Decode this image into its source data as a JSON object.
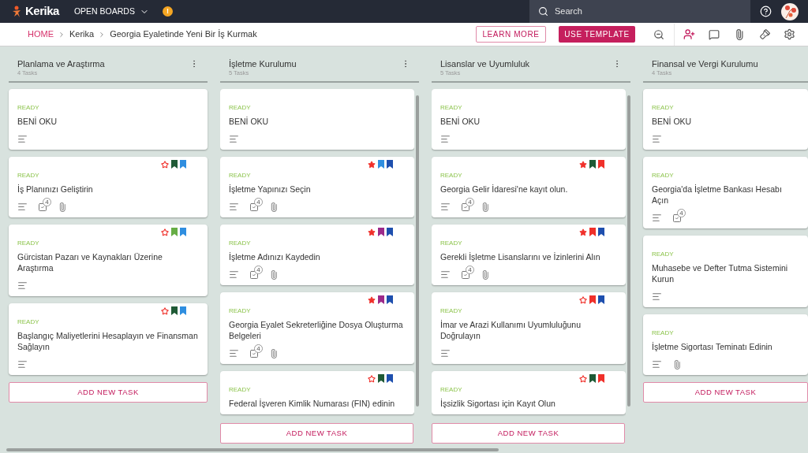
{
  "topbar": {
    "logo": "Kerika",
    "boards_menu": "OPEN BOARDS",
    "alert_badge": "!",
    "search": {
      "placeholder": "Search"
    }
  },
  "breadcrumb": {
    "items": [
      {
        "label": "HOME",
        "kind": "link"
      },
      {
        "label": "Kerika",
        "kind": "text"
      },
      {
        "label": "Georgia Eyaletinde Yeni Bir İş Kurmak",
        "kind": "text"
      }
    ],
    "buttons": [
      {
        "label": "LEARN MORE",
        "kind": "outline"
      },
      {
        "label": "USE TEMPLATE",
        "kind": "filled"
      }
    ]
  },
  "columns": [
    {
      "title": "Planlama ve Araştırma",
      "count": "4 Tasks",
      "has_menu": true,
      "scrolling": false,
      "add_button": "ADD NEW TASK",
      "cards": [
        {
          "status": "READY",
          "title": "BENİ OKU",
          "icons": [
            {
              "kind": "description"
            }
          ]
        },
        {
          "status": "READY",
          "title": "İş Planınızı Geliştirin",
          "starred": false,
          "flags": [
            {
              "color": "#1f5a36"
            },
            {
              "color": "#2f8ee0"
            }
          ],
          "icons": [
            {
              "kind": "description"
            },
            {
              "kind": "checklist",
              "count": "4"
            },
            {
              "kind": "attachment"
            }
          ]
        },
        {
          "status": "READY",
          "title": "Gürcistan Pazarı ve Kaynakları Üzerine Araştırma",
          "starred": false,
          "flags": [
            {
              "color": "#66ad45"
            },
            {
              "color": "#2f8ee0"
            }
          ],
          "icons": [
            {
              "kind": "description"
            }
          ]
        },
        {
          "status": "READY",
          "title": "Başlangıç Maliyetlerini Hesaplayın ve Finansman Sağlayın",
          "starred": false,
          "flags": [
            {
              "color": "#1f5a36"
            },
            {
              "color": "#2f8ee0"
            }
          ],
          "icons": [
            {
              "kind": "description"
            }
          ]
        }
      ]
    },
    {
      "title": "İşletme Kurulumu",
      "count": "5 Tasks",
      "has_menu": true,
      "scrolling": true,
      "add_button": "ADD NEW TASK",
      "cards": [
        {
          "status": "READY",
          "title": "BENİ OKU",
          "icons": [
            {
              "kind": "description"
            }
          ]
        },
        {
          "status": "READY",
          "title": "İşletme Yapınızı Seçin",
          "starred": true,
          "flags": [
            {
              "color": "#2f8ee0"
            },
            {
              "color": "#1e4fae"
            }
          ],
          "icons": [
            {
              "kind": "description"
            },
            {
              "kind": "checklist",
              "count": "4"
            },
            {
              "kind": "attachment"
            }
          ]
        },
        {
          "status": "READY",
          "title": "İşletme Adınızı Kaydedin",
          "starred": true,
          "flags": [
            {
              "color": "#9c2a8a"
            },
            {
              "color": "#1e4fae"
            }
          ],
          "icons": [
            {
              "kind": "description"
            },
            {
              "kind": "checklist",
              "count": "4"
            },
            {
              "kind": "attachment"
            }
          ]
        },
        {
          "status": "READY",
          "title": "Georgia Eyalet Sekreterliğine Dosya Oluşturma Belgeleri",
          "starred": true,
          "flags": [
            {
              "color": "#9c2a8a"
            },
            {
              "color": "#1e4fae"
            }
          ],
          "icons": [
            {
              "kind": "description"
            },
            {
              "kind": "checklist",
              "count": "4"
            },
            {
              "kind": "attachment"
            }
          ]
        },
        {
          "status": "READY",
          "title": "Federal İşveren Kimlik Numarası (FIN) edinin",
          "starred": false,
          "flags": [
            {
              "color": "#1f5a36"
            },
            {
              "color": "#1e4fae"
            }
          ]
        }
      ]
    },
    {
      "title": "Lisanslar ve Uyumluluk",
      "count": "5 Tasks",
      "has_menu": true,
      "scrolling": true,
      "add_button": "ADD NEW TASK",
      "cards": [
        {
          "status": "READY",
          "title": "BENİ OKU",
          "icons": [
            {
              "kind": "description"
            }
          ]
        },
        {
          "status": "READY",
          "title": "Georgia Gelir İdaresi'ne kayıt olun.",
          "starred": true,
          "flags": [
            {
              "color": "#1f5a36"
            },
            {
              "color": "#f0302a"
            }
          ],
          "icons": [
            {
              "kind": "description"
            },
            {
              "kind": "checklist",
              "count": "4"
            },
            {
              "kind": "attachment"
            }
          ]
        },
        {
          "status": "READY",
          "title": "Gerekli İşletme Lisanslarını ve İzinlerini Alın",
          "starred": true,
          "flags": [
            {
              "color": "#f0302a"
            },
            {
              "color": "#1e4fae"
            }
          ],
          "icons": [
            {
              "kind": "description"
            },
            {
              "kind": "checklist",
              "count": "4"
            },
            {
              "kind": "attachment"
            }
          ]
        },
        {
          "status": "READY",
          "title": "İmar ve Arazi Kullanımı Uyumluluğunu Doğrulayın",
          "starred": false,
          "flags": [
            {
              "color": "#f0302a"
            },
            {
              "color": "#1e4fae"
            }
          ],
          "icons": [
            {
              "kind": "description"
            }
          ]
        },
        {
          "status": "READY",
          "title": "İşsizlik Sigortası için Kayıt Olun",
          "starred": false,
          "flags": [
            {
              "color": "#1f5a36"
            },
            {
              "color": "#f0302a"
            }
          ]
        }
      ]
    },
    {
      "title": "Finansal ve Vergi Kurulumu",
      "count": "4 Tasks",
      "has_menu": false,
      "scrolling": false,
      "add_button": "ADD NEW TASK",
      "cards": [
        {
          "status": "READY",
          "title": "BENİ OKU",
          "icons": [
            {
              "kind": "description"
            }
          ]
        },
        {
          "status": "READY",
          "title": "Georgia'da İşletme Bankası Hesabı Açın",
          "icons": [
            {
              "kind": "description"
            },
            {
              "kind": "checklist",
              "count": "4"
            }
          ]
        },
        {
          "status": "READY",
          "title": "Muhasebe ve Defter Tutma Sistemini Kurun",
          "icons": [
            {
              "kind": "description"
            }
          ]
        },
        {
          "status": "READY",
          "title": "İşletme Sigortası Teminatı Edinin",
          "icons": [
            {
              "kind": "description"
            },
            {
              "kind": "attachment"
            }
          ]
        }
      ]
    }
  ]
}
